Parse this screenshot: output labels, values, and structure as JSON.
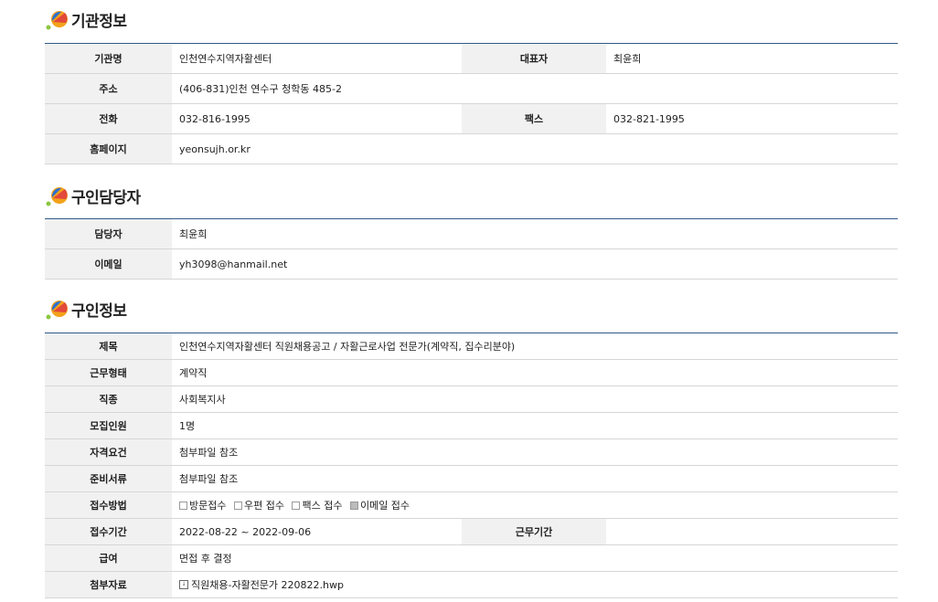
{
  "colors": {
    "accent": "#2f5a86",
    "header_bg": "#f1f1f1",
    "border": "#d6d6d6",
    "logo_blue": "#2b6fd1",
    "logo_orange": "#f3a21a",
    "logo_red": "#e2483c",
    "logo_green": "#8cc63f"
  },
  "org": {
    "title": "기관정보",
    "name_label": "기관명",
    "name": "인천연수지역자활센터",
    "rep_label": "대표자",
    "rep": "최윤희",
    "addr_label": "주소",
    "addr": "(406-831)인천 연수구 청학동 485-2",
    "phone_label": "전화",
    "phone": "032-816-1995",
    "fax_label": "팩스",
    "fax": "032-821-1995",
    "homepage_label": "홈페이지",
    "homepage": "yeonsujh.or.kr"
  },
  "contact": {
    "title": "구인담당자",
    "person_label": "담당자",
    "person": "최윤희",
    "email_label": "이메일",
    "email": "yh3098@hanmail.net"
  },
  "job": {
    "title": "구인정보",
    "subject_label": "제목",
    "subject": "인천연수지역자활센터 직원채용공고 / 자활근로사업 전문가(계약직, 집수리분야)",
    "worktype_label": "근무형태",
    "worktype": "계약직",
    "occupation_label": "직종",
    "occupation": "사회복지사",
    "headcount_label": "모집인원",
    "headcount": "1명",
    "qualification_label": "자격요건",
    "qualification": "첨부파일 참조",
    "documents_label": "준비서류",
    "documents": "첨부파일 참조",
    "method_label": "접수방법",
    "methods": [
      {
        "label": "방문접수",
        "checked": false
      },
      {
        "label": "우편 접수",
        "checked": false
      },
      {
        "label": "팩스 접수",
        "checked": false
      },
      {
        "label": "이메일 접수",
        "checked": true
      }
    ],
    "period_label": "접수기간",
    "period": "2022-08-22 ~ 2022-09-06",
    "workperiod_label": "근무기간",
    "workperiod": "",
    "salary_label": "급여",
    "salary": "면접 후 결정",
    "attachment_label": "첨부자료",
    "attachment": "직원채용-자활전문가 220822.hwp",
    "attachment_icon": "file-icon"
  }
}
